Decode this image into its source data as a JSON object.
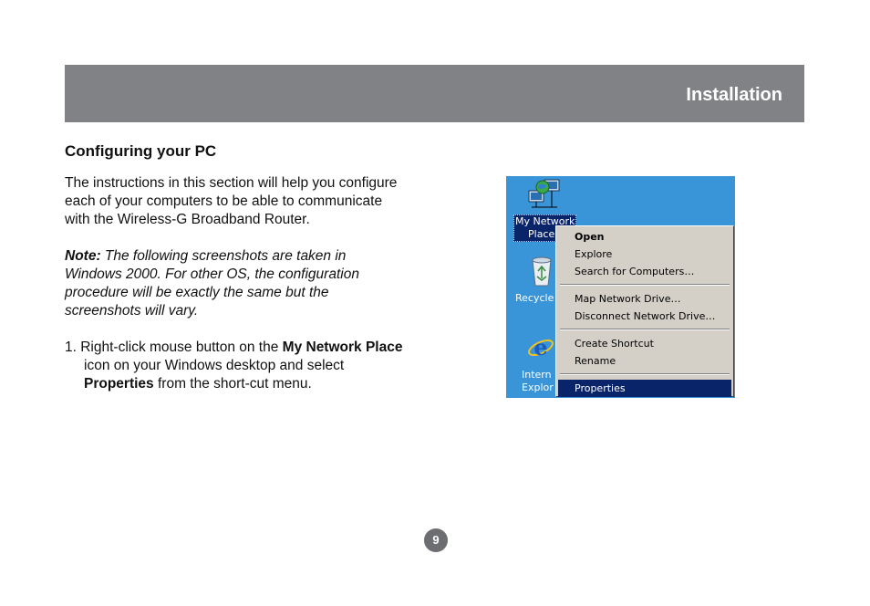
{
  "header": {
    "title": "Installation"
  },
  "section": {
    "title": "Configuring your PC"
  },
  "intro": {
    "lines": [
      "The instructions in this section will help you configure",
      "each of your computers to be able to communicate",
      "with the Wireless-G Broadband Router."
    ]
  },
  "note": {
    "label": "Note:",
    "line1_rest": " The following screenshots are taken in",
    "lines": [
      "Windows 2000. For other OS, the configuration",
      "procedure will be exactly the same but the",
      "screenshots will vary."
    ]
  },
  "step1": {
    "prefix": "1. Right-click mouse button on the ",
    "bold1": "My Network Place",
    "line2": "icon on your Windows desktop and select",
    "bold2": "Properties",
    "suffix": " from the short-cut menu."
  },
  "screenshot": {
    "desktop_background": "#3a95d8",
    "icons": [
      {
        "name": "network-places-icon",
        "label_lines": [
          "My Network",
          "Place"
        ]
      },
      {
        "name": "recycle-bin-icon",
        "label_lines": [
          "Recycle"
        ]
      },
      {
        "name": "internet-explorer-icon",
        "label_lines": [
          "Intern",
          "Explor"
        ]
      }
    ],
    "context_menu": {
      "groups": [
        [
          "Open",
          "Explore",
          "Search for Computers…"
        ],
        [
          "Map Network Drive…",
          "Disconnect Network Drive…"
        ],
        [
          "Create Shortcut",
          "Rename"
        ],
        [
          "Properties"
        ]
      ],
      "bold_item": "Open",
      "highlighted_item": "Properties"
    }
  },
  "page": {
    "number": "9"
  },
  "colors": {
    "header_bar": "#808285",
    "page_badge": "#6d6e71",
    "menu_highlight": "#0a246a"
  }
}
